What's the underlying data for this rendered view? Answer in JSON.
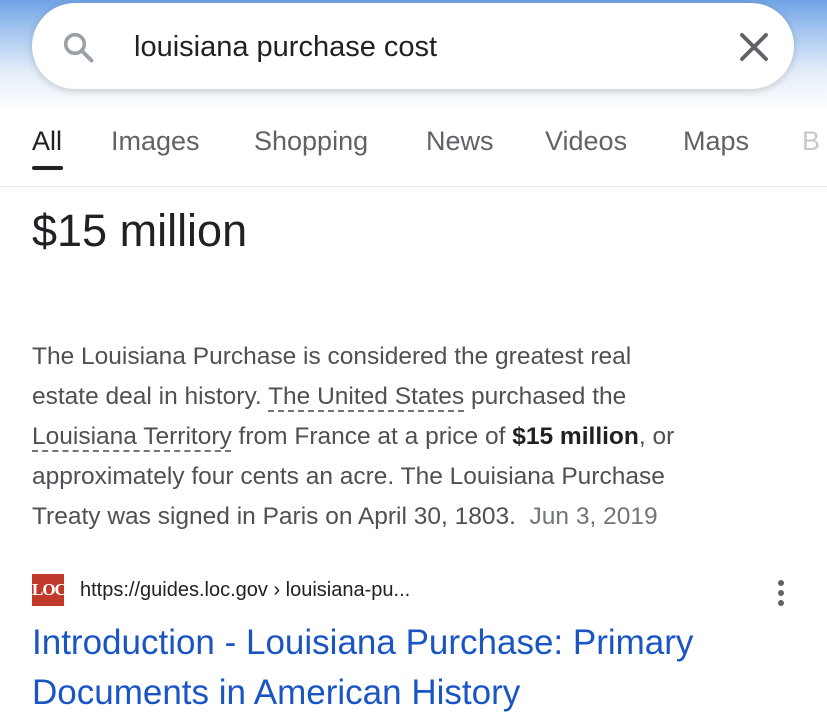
{
  "search": {
    "query": "louisiana purchase cost",
    "search_icon": "search-icon",
    "clear_icon": "close-icon"
  },
  "tabs": [
    {
      "label": "All",
      "active": true
    },
    {
      "label": "Images"
    },
    {
      "label": "Shopping"
    },
    {
      "label": "News"
    },
    {
      "label": "Videos"
    },
    {
      "label": "Maps"
    },
    {
      "label": "B"
    }
  ],
  "featured": {
    "answer": "$15 million",
    "snippet": {
      "l1": "The Louisiana Purchase is considered the greatest real",
      "l2_a": "estate deal in history. ",
      "l2_link": "The United States",
      "l2_b": " purchased the",
      "l3_link": "Louisiana Territory",
      "l3_a": " from France at a price of ",
      "l3_bold": "$15 million",
      "l3_b": ", or",
      "l4": "approximately four cents an acre. The Louisiana Purchase",
      "l5": "Treaty was signed in Paris on April 30, 1803.",
      "date": "Jun 3, 2019"
    }
  },
  "result": {
    "logo_text": "LOC",
    "url": "https://guides.loc.gov › louisiana-pu...",
    "more_icon": "more-vert-icon",
    "title_line1": "Introduction - Louisiana Purchase: Primary",
    "title_line2": "Documents in American History"
  },
  "colors": {
    "link_blue": "#1a55c4",
    "text": "#202124",
    "secondary": "#4d5156",
    "loc_red": "#c0392b"
  }
}
